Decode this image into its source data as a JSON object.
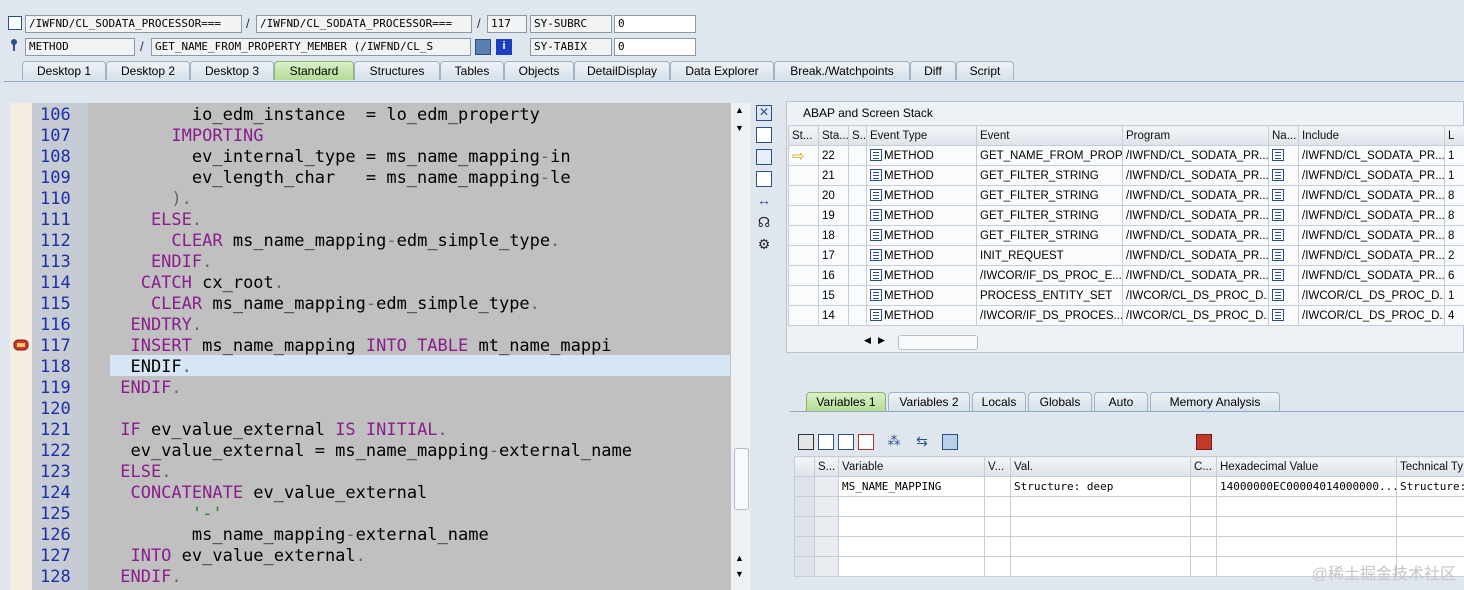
{
  "header": {
    "program1": "/IWFND/CL_SODATA_PROCESSOR===",
    "program2": "/IWFND/CL_SODATA_PROCESSOR===",
    "line": "117",
    "subrc_label": "SY-SUBRC",
    "subrc_value": "0",
    "kind": "METHOD",
    "method": "GET_NAME_FROM_PROPERTY_MEMBER (/IWFND/CL_S",
    "tabix_label": "SY-TABIX",
    "tabix_value": "0",
    "sep": "/"
  },
  "tabs": [
    "Desktop 1",
    "Desktop 2",
    "Desktop 3",
    "Standard",
    "Structures",
    "Tables",
    "Objects",
    "DetailDisplay",
    "Data Explorer",
    "Break./Watchpoints",
    "Diff",
    "Script"
  ],
  "editor": {
    "lines": [
      {
        "n": "106",
        "parts": [
          [
            "",
            "        io_edm_instance  = lo_edm_property"
          ]
        ]
      },
      {
        "n": "107",
        "parts": [
          [
            "kw",
            "      IMPORTING"
          ]
        ]
      },
      {
        "n": "108",
        "parts": [
          [
            "",
            "        ev_internal_type = ms_name_mapping"
          ],
          [
            "pt",
            "-"
          ],
          [
            "",
            "in"
          ]
        ]
      },
      {
        "n": "109",
        "parts": [
          [
            "",
            "        ev_length_char   = ms_name_mapping"
          ],
          [
            "pt",
            "-"
          ],
          [
            "",
            "le"
          ]
        ]
      },
      {
        "n": "110",
        "parts": [
          [
            "pt",
            "      )."
          ]
        ]
      },
      {
        "n": "111",
        "parts": [
          [
            "kw",
            "    ELSE"
          ],
          [
            "pt",
            "."
          ]
        ]
      },
      {
        "n": "112",
        "parts": [
          [
            "kw",
            "      CLEAR"
          ],
          [
            "",
            " ms_name_mapping"
          ],
          [
            "pt",
            "-"
          ],
          [
            "",
            "edm_simple_type"
          ],
          [
            "pt",
            "."
          ]
        ]
      },
      {
        "n": "113",
        "parts": [
          [
            "kw",
            "    ENDIF"
          ],
          [
            "pt",
            "."
          ]
        ]
      },
      {
        "n": "114",
        "parts": [
          [
            "kw",
            "   CATCH"
          ],
          [
            "",
            " cx_root"
          ],
          [
            "pt",
            "."
          ]
        ]
      },
      {
        "n": "115",
        "parts": [
          [
            "kw",
            "    CLEAR"
          ],
          [
            "",
            " ms_name_mapping"
          ],
          [
            "pt",
            "-"
          ],
          [
            "",
            "edm_simple_type"
          ],
          [
            "pt",
            "."
          ]
        ]
      },
      {
        "n": "116",
        "parts": [
          [
            "kw",
            "  ENDTRY"
          ],
          [
            "pt",
            "."
          ]
        ]
      },
      {
        "n": "117",
        "parts": [
          [
            "kw",
            "  INSERT"
          ],
          [
            "",
            " ms_name_mapping "
          ],
          [
            "kw",
            "INTO TABLE"
          ],
          [
            "",
            " mt_name_mappi"
          ]
        ]
      },
      {
        "n": "118",
        "parts": [
          [
            "",
            "  ENDIF"
          ],
          [
            "pt",
            "."
          ]
        ]
      },
      {
        "n": "119",
        "parts": [
          [
            "kw",
            " ENDIF"
          ],
          [
            "pt",
            "."
          ]
        ]
      },
      {
        "n": "120",
        "parts": [
          [
            "",
            ""
          ]
        ]
      },
      {
        "n": "121",
        "parts": [
          [
            "kw",
            " IF"
          ],
          [
            "",
            " ev_value_external "
          ],
          [
            "kw",
            "IS INITIAL"
          ],
          [
            "pt",
            "."
          ]
        ]
      },
      {
        "n": "122",
        "parts": [
          [
            "",
            "  ev_value_external = ms_name_mapping"
          ],
          [
            "pt",
            "-"
          ],
          [
            "",
            "external_name"
          ]
        ]
      },
      {
        "n": "123",
        "parts": [
          [
            "kw",
            " ELSE"
          ],
          [
            "pt",
            "."
          ]
        ]
      },
      {
        "n": "124",
        "parts": [
          [
            "kw",
            "  CONCATENATE"
          ],
          [
            "",
            " ev_value_external"
          ]
        ]
      },
      {
        "n": "125",
        "parts": [
          [
            "str",
            "        '-'"
          ]
        ]
      },
      {
        "n": "126",
        "parts": [
          [
            "",
            "        ms_name_mapping"
          ],
          [
            "pt",
            "-"
          ],
          [
            "",
            "external_name"
          ]
        ]
      },
      {
        "n": "127",
        "parts": [
          [
            "kw",
            "  INTO"
          ],
          [
            "",
            " ev_value_external"
          ],
          [
            "pt",
            "."
          ]
        ]
      },
      {
        "n": "128",
        "parts": [
          [
            "kw",
            " ENDIF"
          ],
          [
            "pt",
            "."
          ]
        ]
      }
    ]
  },
  "stack": {
    "title": "ABAP and Screen Stack",
    "columns": [
      "St...",
      "Sta...",
      "S...",
      "Event Type",
      "Event",
      "Program",
      "Na...",
      "Include",
      "L"
    ],
    "rows": [
      {
        "level": "22",
        "type": "METHOD",
        "event": "GET_NAME_FROM_PROP...",
        "program": "/IWFND/CL_SODATA_PR...",
        "include": "/IWFND/CL_SODATA_PR...",
        "l": "1",
        "current": true
      },
      {
        "level": "21",
        "type": "METHOD",
        "event": "GET_FILTER_STRING",
        "program": "/IWFND/CL_SODATA_PR...",
        "include": "/IWFND/CL_SODATA_PR...",
        "l": "1"
      },
      {
        "level": "20",
        "type": "METHOD",
        "event": "GET_FILTER_STRING",
        "program": "/IWFND/CL_SODATA_PR...",
        "include": "/IWFND/CL_SODATA_PR...",
        "l": "8"
      },
      {
        "level": "19",
        "type": "METHOD",
        "event": "GET_FILTER_STRING",
        "program": "/IWFND/CL_SODATA_PR...",
        "include": "/IWFND/CL_SODATA_PR...",
        "l": "8"
      },
      {
        "level": "18",
        "type": "METHOD",
        "event": "GET_FILTER_STRING",
        "program": "/IWFND/CL_SODATA_PR...",
        "include": "/IWFND/CL_SODATA_PR...",
        "l": "8"
      },
      {
        "level": "17",
        "type": "METHOD",
        "event": "INIT_REQUEST",
        "program": "/IWFND/CL_SODATA_PR...",
        "include": "/IWFND/CL_SODATA_PR...",
        "l": "2"
      },
      {
        "level": "16",
        "type": "METHOD",
        "event": "/IWCOR/IF_DS_PROC_E...",
        "program": "/IWFND/CL_SODATA_PR...",
        "include": "/IWFND/CL_SODATA_PR...",
        "l": "6"
      },
      {
        "level": "15",
        "type": "METHOD",
        "event": "PROCESS_ENTITY_SET",
        "program": "/IWCOR/CL_DS_PROC_D...",
        "include": "/IWCOR/CL_DS_PROC_D...",
        "l": "1"
      },
      {
        "level": "14",
        "type": "METHOD",
        "event": "/IWCOR/IF_DS_PROCES...",
        "program": "/IWCOR/CL_DS_PROC_D...",
        "include": "/IWCOR/CL_DS_PROC_D...",
        "l": "4"
      }
    ]
  },
  "vartabs": [
    "Variables 1",
    "Variables 2",
    "Locals",
    "Globals",
    "Auto",
    "Memory Analysis"
  ],
  "variables": {
    "columns": [
      "S...",
      "Variable",
      "V...",
      "Val.",
      "C...",
      "Hexadecimal Value",
      "Technical Ty"
    ],
    "rows": [
      {
        "name": "MS_NAME_MAPPING",
        "value": "Structure: deep",
        "hex": "14000000EC00004014000000...",
        "tech": "Structure: d"
      }
    ]
  },
  "watermark": "@稀土掘金技术社区"
}
